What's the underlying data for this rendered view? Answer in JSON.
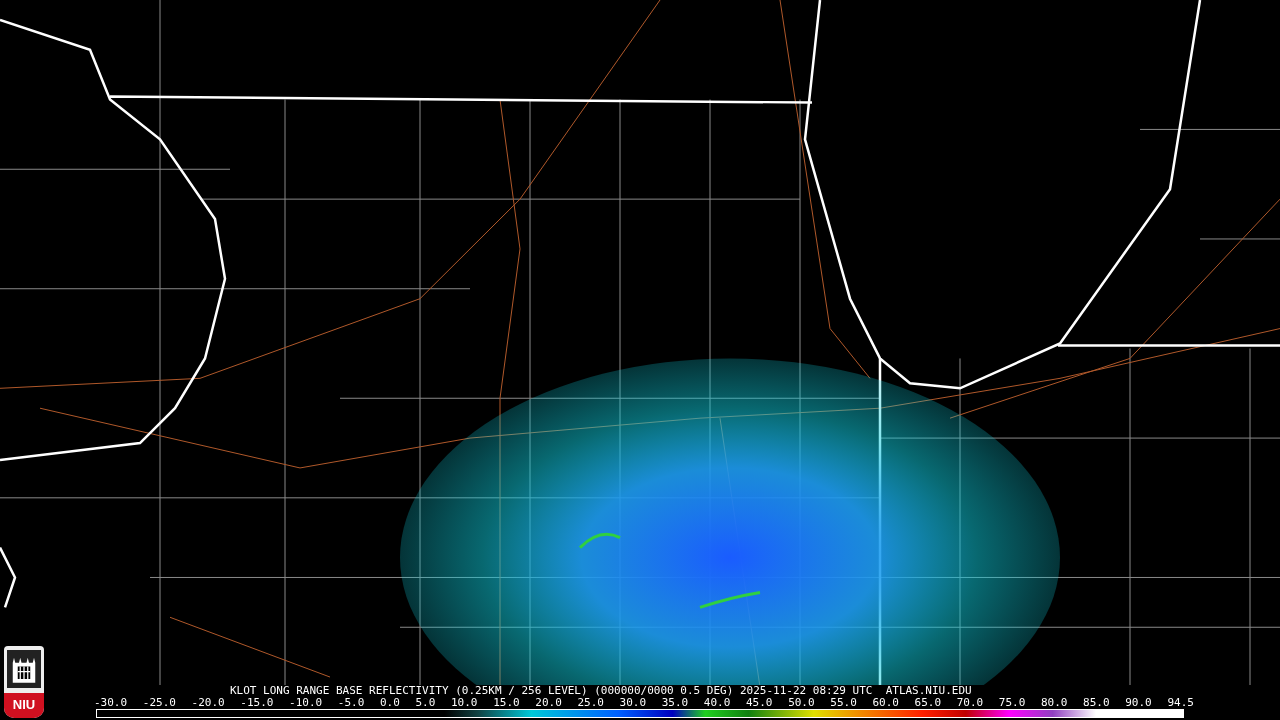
{
  "logo": {
    "text": "NIU"
  },
  "caption": "KLOT LONG RANGE BASE REFLECTIVITY (0.25KM / 256 LEVEL) (000000/0000 0.5 DEG) 2025-11-22 08:29 UTC  ATLAS.NIU.EDU",
  "scale_labels": [
    "-30.0",
    "-25.0",
    "-20.0",
    "-15.0",
    "-10.0",
    "-5.0",
    "0.0",
    "5.0",
    "10.0",
    "15.0",
    "20.0",
    "25.0",
    "30.0",
    "35.0",
    "40.0",
    "45.0",
    "50.0",
    "55.0",
    "60.0",
    "65.0",
    "70.0",
    "75.0",
    "80.0",
    "85.0",
    "90.0",
    "94.5"
  ]
}
